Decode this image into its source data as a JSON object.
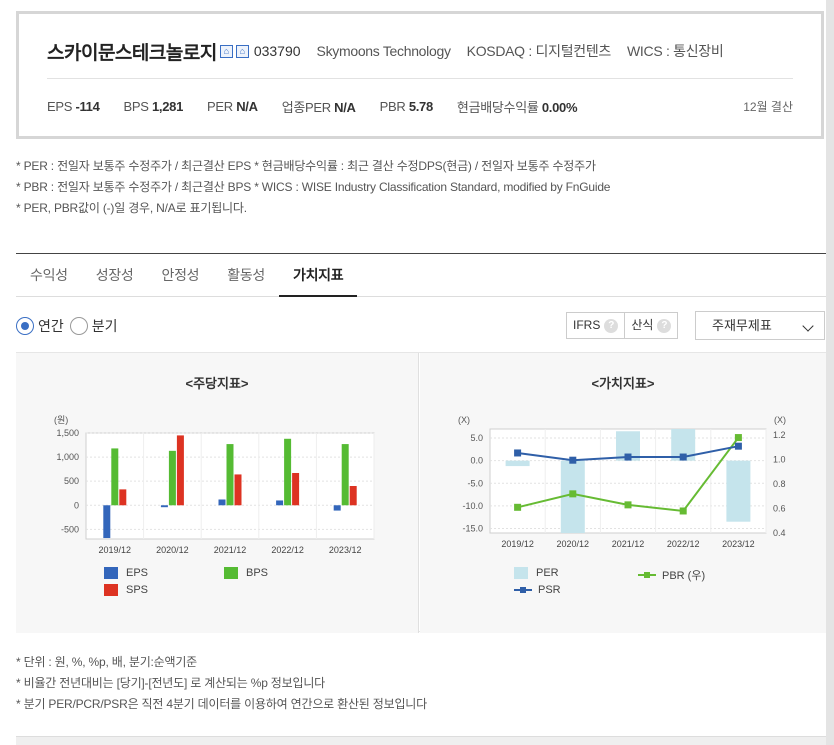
{
  "company": {
    "name": "스카이문스테크놀로지",
    "code": "033790",
    "english_name": "Skymoons Technology",
    "market": "KOSDAQ : 디지털컨텐츠",
    "wics": "WICS : 통신장비",
    "icon1": "⌂",
    "icon2": "⌂"
  },
  "metrics": {
    "eps_label": "EPS",
    "eps_value": "-114",
    "bps_label": "BPS",
    "bps_value": "1,281",
    "per_label": "PER",
    "per_value": "N/A",
    "sector_per_label": "업종PER",
    "sector_per_value": "N/A",
    "pbr_label": "PBR",
    "pbr_value": "5.78",
    "div_label": "현금배당수익률",
    "div_value": "0.00%",
    "settlement": "12월 결산"
  },
  "notes": [
    "* PER : 전일자 보통주 수정주가 / 최근결산 EPS * 현금배당수익률 : 최근 결산 수정DPS(현금) / 전일자 보통주 수정주가",
    "* PBR : 전일자 보통주 수정주가 / 최근결산 BPS * WICS : WISE Industry Classification Standard, modified by FnGuide",
    "* PER, PBR값이 (-)일 경우, N/A로 표기됩니다."
  ],
  "tabs": [
    "수익성",
    "성장성",
    "안정성",
    "활동성",
    "가치지표"
  ],
  "period": {
    "annual": "연간",
    "quarter": "분기"
  },
  "buttons": {
    "ifrs": "IFRS",
    "calc": "산식",
    "q": "?",
    "select": "주재무제표"
  },
  "colors": {
    "eps": "#3366bb",
    "bps": "#55bb33",
    "sps": "#dd3322",
    "per": "#c5e4ec",
    "pbr": "#66bb33",
    "psr": "#2f5fa8"
  },
  "chart_data": [
    {
      "type": "bar",
      "title": "<주당지표>",
      "ylabel": "(원)",
      "categories": [
        "2019/12",
        "2020/12",
        "2021/12",
        "2022/12",
        "2023/12"
      ],
      "ylim": [
        -700,
        1500
      ],
      "yticks": [
        1500,
        1000,
        500,
        0,
        -500
      ],
      "ytick_labels": [
        "1,500",
        "1,000",
        "500",
        "0",
        "-500"
      ],
      "series": [
        {
          "name": "EPS",
          "values": [
            -680,
            -40,
            120,
            100,
            -110
          ]
        },
        {
          "name": "BPS",
          "values": [
            1180,
            1130,
            1270,
            1380,
            1270
          ]
        },
        {
          "name": "SPS",
          "values": [
            330,
            1450,
            640,
            670,
            400
          ]
        }
      ]
    },
    {
      "type": "bar+line",
      "title": "<가치지표>",
      "ylabel_left": "(X)",
      "ylabel_right": "(X)",
      "categories": [
        "2019/12",
        "2020/12",
        "2021/12",
        "2022/12",
        "2023/12"
      ],
      "ylim_left": [
        -16,
        7
      ],
      "yticks_left": [
        5.0,
        0.0,
        -5.0,
        -10.0,
        -15.0
      ],
      "ytick_labels_left": [
        "5.0",
        "0.0",
        "-5.0",
        "-10.0",
        "-15.0"
      ],
      "ylim_right": [
        0.4,
        1.25
      ],
      "yticks_right": [
        1.2,
        1.0,
        0.8,
        0.6,
        0.4
      ],
      "ytick_labels_right": [
        "1.2",
        "1.0",
        "0.8",
        "0.6",
        "0.4"
      ],
      "series": [
        {
          "name": "PER",
          "axis": "left",
          "style": "bar",
          "values": [
            -1.2,
            -17.5,
            6.5,
            8.5,
            -13.5
          ]
        },
        {
          "name": "PBR (우)",
          "axis": "right",
          "style": "line",
          "values": [
            0.61,
            0.72,
            0.63,
            0.58,
            1.18
          ]
        },
        {
          "name": "PSR",
          "axis": "left",
          "style": "line",
          "values": [
            1.7,
            0.1,
            0.8,
            0.8,
            3.2
          ]
        }
      ]
    }
  ],
  "footnotes": [
    "* 단위 : 원, %, %p, 배, 분기:순액기준",
    "* 비율간 전년대비는 [당기]-[전년도] 로 계산되는 %p 정보입니다",
    "* 분기 PER/PCR/PSR은 직전 4분기 데이터를 이용하여 연간으로 환산된 정보입니다"
  ]
}
